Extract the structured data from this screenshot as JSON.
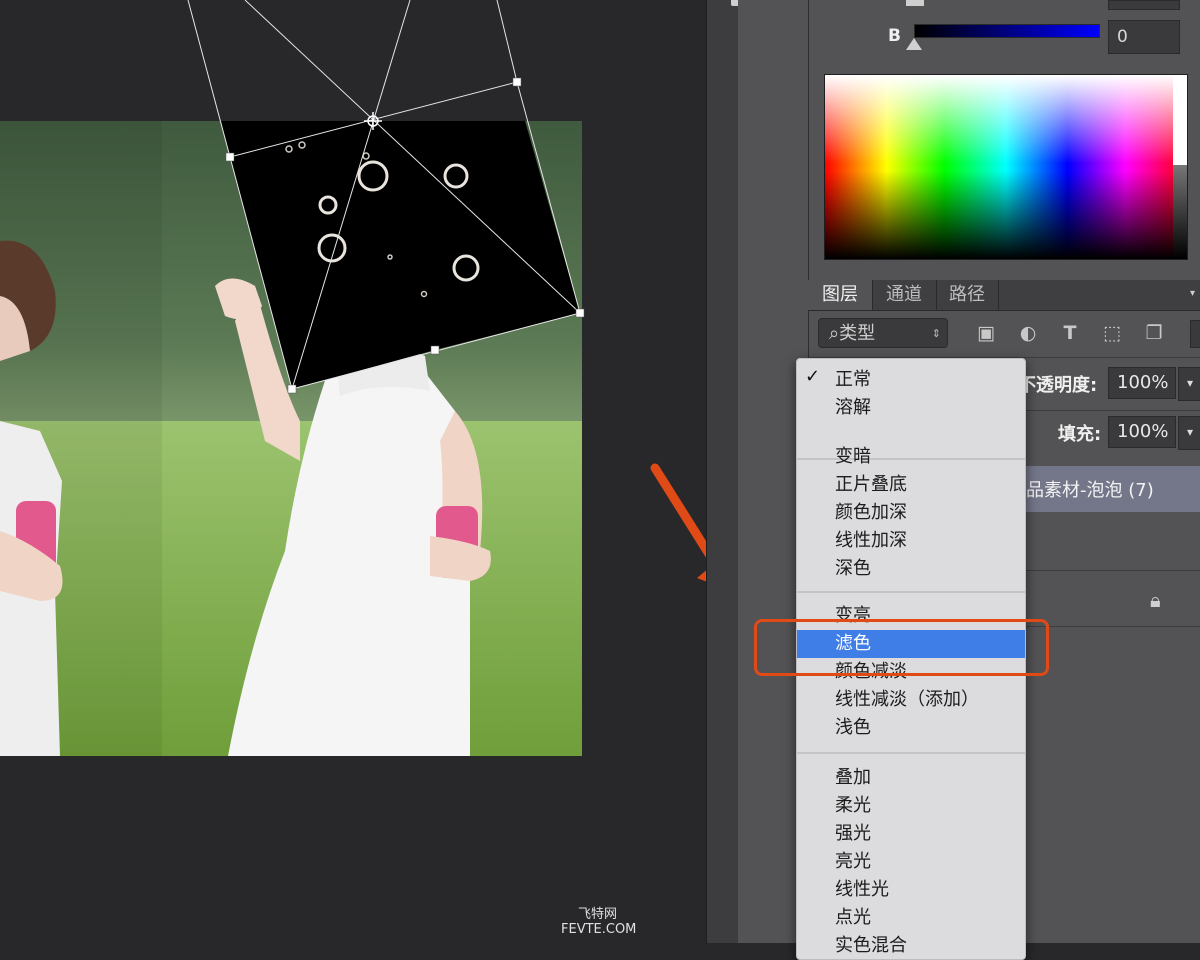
{
  "color_panel": {
    "channel_label": "B",
    "channel_value": "0",
    "top_value": ""
  },
  "layers_panel": {
    "tabs": [
      "图层",
      "通道",
      "路径"
    ],
    "kind_filter": "类型",
    "opacity_label": "不透明度:",
    "opacity_value": "100%",
    "fill_label": "填充:",
    "fill_value": "100%",
    "selected_layer_name": "品素材-泡泡 (7)"
  },
  "blend_menu": {
    "groups": [
      [
        "正常",
        "溶解"
      ],
      [
        "变暗",
        "正片叠底",
        "颜色加深",
        "线性加深",
        "深色"
      ],
      [
        "变亮",
        "滤色",
        "颜色减淡",
        "线性减淡（添加）",
        "浅色"
      ],
      [
        "叠加",
        "柔光",
        "强光",
        "亮光",
        "线性光",
        "点光",
        "实色混合"
      ]
    ],
    "checked": "正常",
    "highlighted": "滤色",
    "check_mark": "✓"
  },
  "colors": {
    "highlight_annotation": "#e04a17",
    "menu_selection": "#3f7ee6"
  },
  "watermark": {
    "cn": "飞特网",
    "en": "FEVTE.COM"
  }
}
